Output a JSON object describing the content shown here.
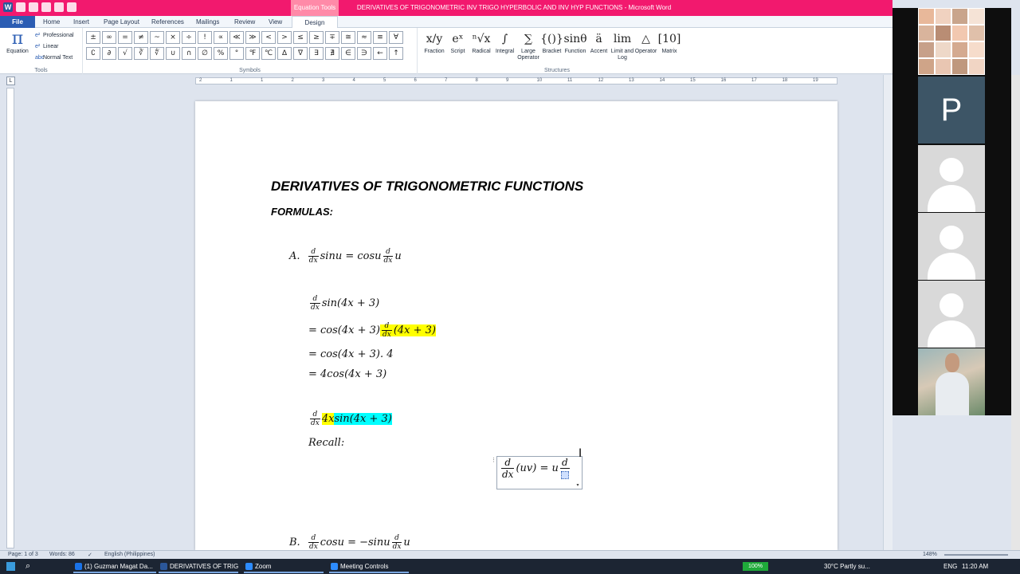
{
  "title_bar": {
    "context_tab": "Equation Tools",
    "document_title": "DERIVATIVES OF TRIGONOMETRIC INV TRIGO HYPERBOLIC AND INV HYP FUNCTIONS - Microsoft Word"
  },
  "tabs": [
    "File",
    "Home",
    "Insert",
    "Page Layout",
    "References",
    "Mailings",
    "Review",
    "View",
    "Design"
  ],
  "ribbon": {
    "tools_group": {
      "equation_label": "Equation",
      "options": [
        "Professional",
        "Linear",
        "Normal Text"
      ],
      "label": "Tools"
    },
    "symbols_group": {
      "label": "Symbols",
      "symbols": [
        "±",
        "∞",
        "=",
        "≠",
        "~",
        "×",
        "÷",
        "!",
        "∝",
        "≪",
        "≫",
        "<",
        ">",
        "≤",
        "≥",
        "∓",
        "≅",
        "≈",
        "≡",
        "∀",
        "∁",
        "∂",
        "√",
        "∛",
        "∜",
        "∪",
        "∩",
        "∅",
        "%",
        "°",
        "℉",
        "℃",
        "∆",
        "∇",
        "∃",
        "∄",
        "∈",
        "∋",
        "←",
        "↑"
      ]
    },
    "structures_group": {
      "label": "Structures",
      "items": [
        {
          "glyph": "x/y",
          "label": "Fraction"
        },
        {
          "glyph": "eˣ",
          "label": "Script"
        },
        {
          "glyph": "ⁿ√x",
          "label": "Radical"
        },
        {
          "glyph": "∫",
          "label": "Integral"
        },
        {
          "glyph": "∑",
          "label": "Large Operator"
        },
        {
          "glyph": "{()}",
          "label": "Bracket"
        },
        {
          "glyph": "sinθ",
          "label": "Function"
        },
        {
          "glyph": "ä",
          "label": "Accent"
        },
        {
          "glyph": "lim",
          "label": "Limit and Log"
        },
        {
          "glyph": "△",
          "label": "Operator"
        },
        {
          "glyph": "[10]",
          "label": "Matrix"
        }
      ]
    }
  },
  "ruler": {
    "ticks": [
      "2",
      "1",
      "1",
      "2",
      "3",
      "4",
      "5",
      "6",
      "7",
      "8",
      "9",
      "10",
      "11",
      "12",
      "13",
      "14",
      "15",
      "16",
      "17",
      "18",
      "19"
    ]
  },
  "document": {
    "heading": "DERIVATIVES OF TRIGONOMETRIC FUNCTIONS",
    "subheading": "FORMULAS:",
    "formula_a_label": "A.",
    "formula_a_lhs": "sinu = cosu",
    "formula_a_rhs": "u",
    "frac_d": "d",
    "frac_dx": "dx",
    "ex1_line1": "sin(4x + 3)",
    "ex1_line2_prefix": "= cos(4x + 3)",
    "ex1_line2_hl": "(4x + 3)",
    "ex1_line3": "= cos(4x + 3). 4",
    "ex1_line4": "= 4cos(4x + 3)",
    "ex2_hl_yellow": "4x",
    "ex2_hl_cyan": "sin(4x + 3)",
    "recall": "Recall:",
    "eqbox_mid": "(uv) = u",
    "formula_b_label": "B.",
    "formula_b_lhs": "cosu = −sinu",
    "formula_b_rhs": "u"
  },
  "status_bar": {
    "page": "Page: 1 of 3",
    "words": "Words: 86",
    "language": "English (Philippines)",
    "zoom": "148%"
  },
  "taskbar": {
    "apps": [
      {
        "label": "(1) Guzman Magat Da..."
      },
      {
        "label": "DERIVATIVES OF TRIG..."
      },
      {
        "label": "Zoom"
      },
      {
        "label": "Meeting Controls"
      }
    ],
    "battery": "100%",
    "weather": "30°C  Partly su...",
    "lang": "ENG",
    "time": "11:20 AM"
  },
  "gallery": {
    "participants": [
      {
        "type": "photo-collage"
      },
      {
        "type": "initial",
        "initial": "P"
      },
      {
        "type": "avatar"
      },
      {
        "type": "avatar"
      },
      {
        "type": "avatar"
      },
      {
        "type": "video"
      }
    ]
  }
}
